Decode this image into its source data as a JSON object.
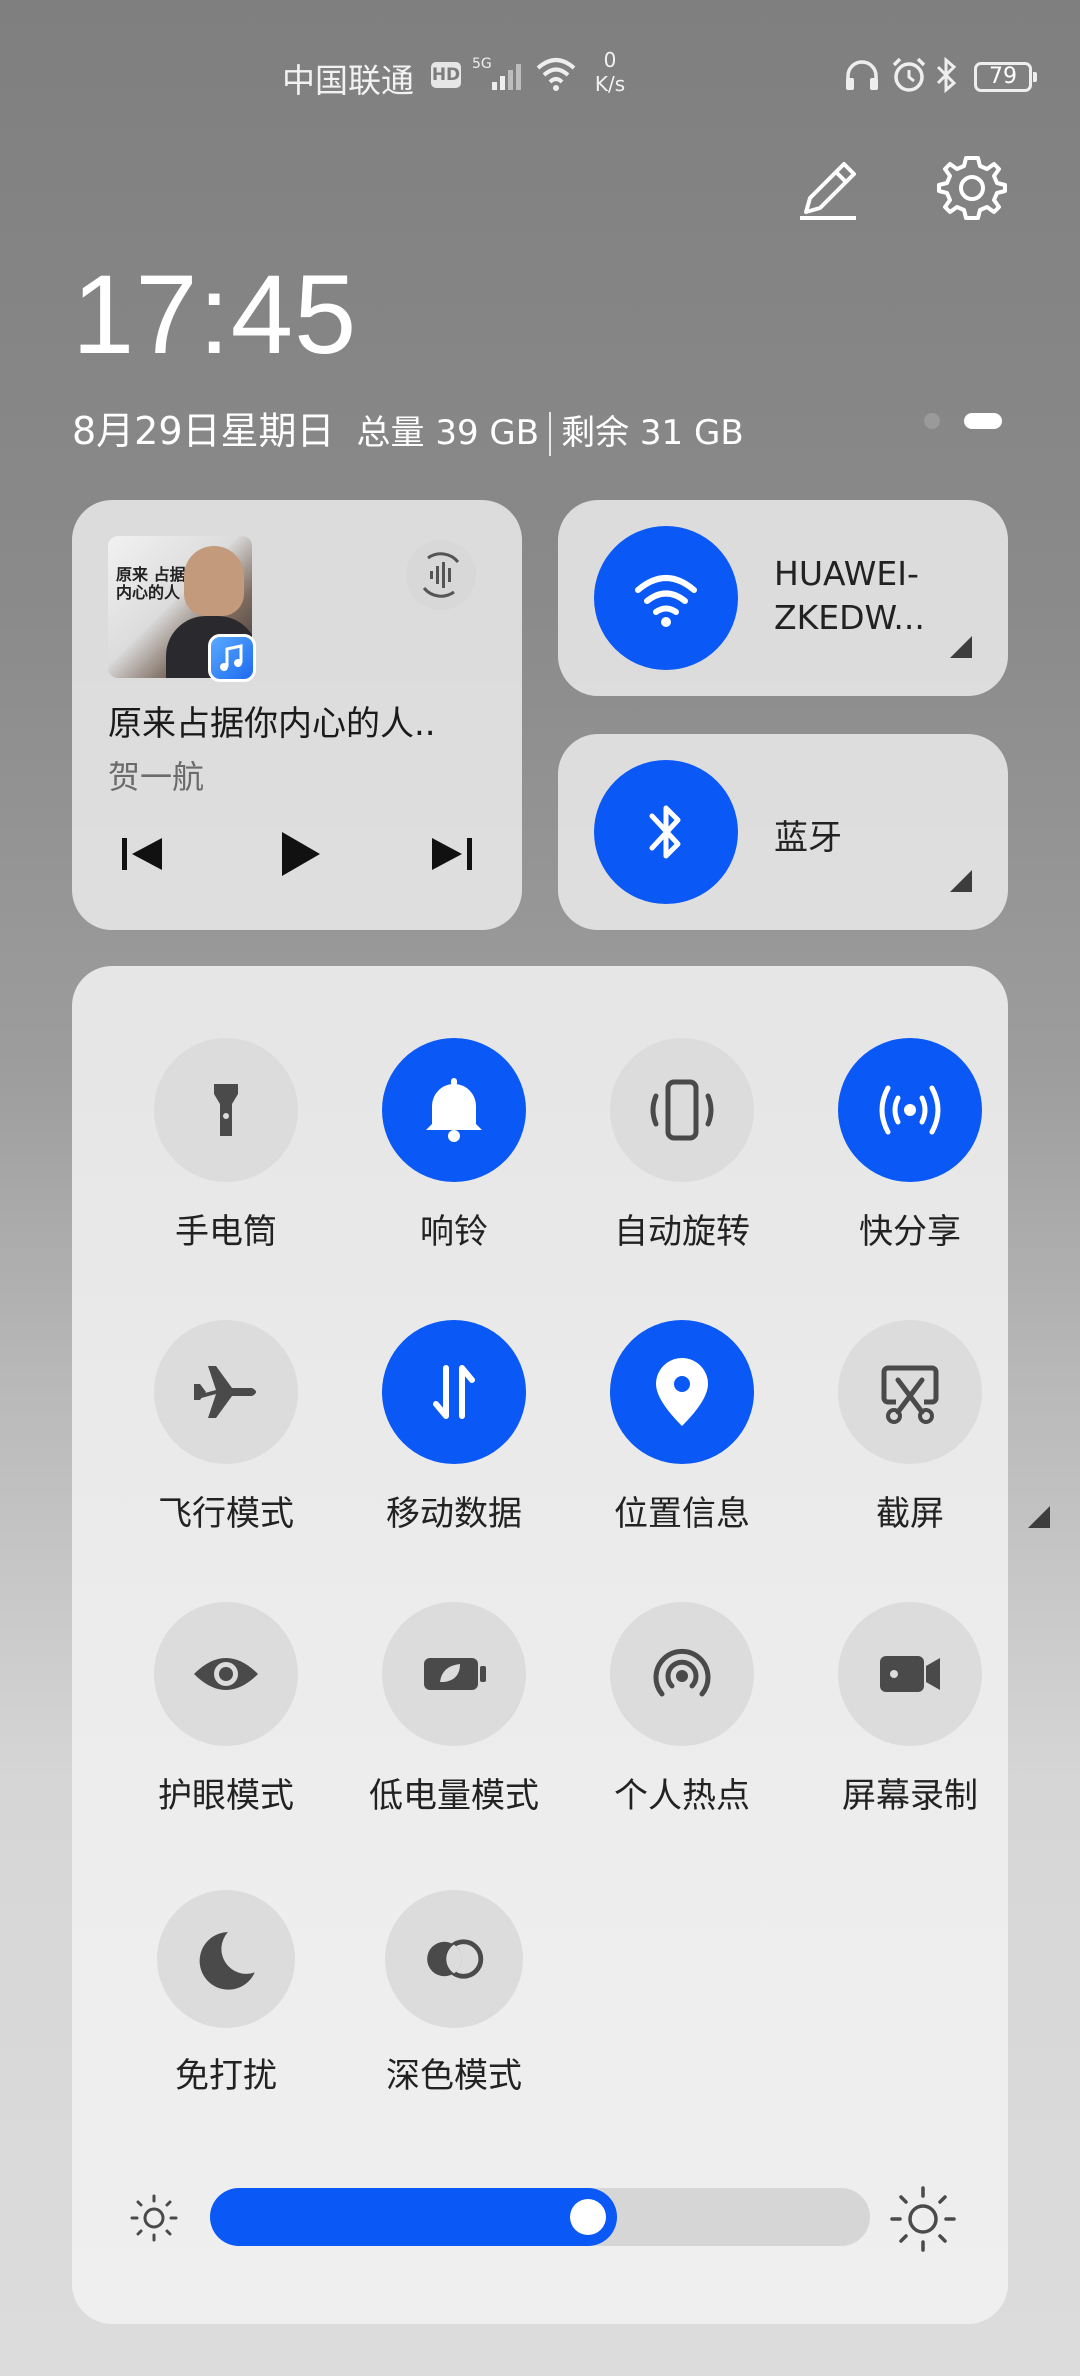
{
  "status_bar": {
    "carrier": "中国联通",
    "hd_badge": "HD",
    "net_type": "5G",
    "net_speed_value": "0",
    "net_speed_unit": "K/s",
    "battery": "79"
  },
  "header": {
    "time": "17:45",
    "date": "8月29日星期日",
    "storage_total": "总量 39 GB",
    "storage_free": "剩余 31 GB",
    "page_count": 2,
    "current_page": 2
  },
  "music": {
    "song_title": "原来占据你内心的人..",
    "artist": "贺一航",
    "cover_text": "原来 占据你内心的人"
  },
  "wifi": {
    "name": "HUAWEI-ZKEDW...",
    "name_line1": "HUAWEI-",
    "name_line2": "ZKEDW...",
    "enabled": true
  },
  "bluetooth": {
    "label": "蓝牙",
    "enabled": true
  },
  "toggles": [
    {
      "label": "手电筒",
      "icon": "flashlight-icon",
      "on": false
    },
    {
      "label": "响铃",
      "icon": "bell-icon",
      "on": true
    },
    {
      "label": "自动旋转",
      "icon": "auto-rotate-icon",
      "on": false
    },
    {
      "label": "快分享",
      "icon": "quick-share-icon",
      "on": true
    },
    {
      "label": "飞行模式",
      "icon": "airplane-icon",
      "on": false
    },
    {
      "label": "移动数据",
      "icon": "mobile-data-icon",
      "on": true
    },
    {
      "label": "位置信息",
      "icon": "location-icon",
      "on": true
    },
    {
      "label": "截屏",
      "icon": "screenshot-icon",
      "on": false
    },
    {
      "label": "护眼模式",
      "icon": "eye-icon",
      "on": false
    },
    {
      "label": "低电量模式",
      "icon": "battery-saver-icon",
      "on": false
    },
    {
      "label": "个人热点",
      "icon": "hotspot-icon",
      "on": false
    },
    {
      "label": "屏幕录制",
      "icon": "screen-record-icon",
      "on": false
    },
    {
      "label": "免打扰",
      "icon": "moon-icon",
      "on": false
    },
    {
      "label": "深色模式",
      "icon": "dark-mode-icon",
      "on": false
    }
  ],
  "brightness": {
    "level": 0.58
  },
  "colors": {
    "accent": "#0a58f5",
    "tile_off": "#dcdcdc",
    "icon_dark": "#4a4a4a"
  }
}
